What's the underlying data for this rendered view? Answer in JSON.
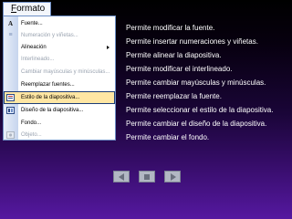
{
  "menu": {
    "title_mnemonic": "F",
    "title_rest": "ormato",
    "items": [
      {
        "label": "Fuente...",
        "icon": "font-A-icon",
        "disabled": false,
        "highlighted": false,
        "submenu": false
      },
      {
        "label": "Numeración y viñetas...",
        "icon": "numbering-icon",
        "disabled": true,
        "highlighted": false,
        "submenu": false
      },
      {
        "label": "Alineación",
        "icon": "align-icon",
        "disabled": false,
        "highlighted": false,
        "submenu": true
      },
      {
        "label": "Interlineado...",
        "icon": "line-spacing-icon",
        "disabled": true,
        "highlighted": false,
        "submenu": false
      },
      {
        "label": "Cambiar mayúsculas y minúsculas...",
        "icon": "change-case-icon",
        "disabled": true,
        "highlighted": false,
        "submenu": false
      },
      {
        "label": "Reemplazar fuentes...",
        "icon": "replace-fonts-icon",
        "disabled": false,
        "highlighted": false,
        "submenu": false
      },
      {
        "label": "Estilo de la diapositiva...",
        "icon": "slide-style-icon",
        "disabled": false,
        "highlighted": true,
        "submenu": false
      },
      {
        "label": "Diseño de la diapositiva...",
        "icon": "slide-layout-icon",
        "disabled": false,
        "highlighted": false,
        "submenu": false
      },
      {
        "label": "Fondo...",
        "icon": "background-icon",
        "disabled": false,
        "highlighted": false,
        "submenu": false
      },
      {
        "label": "Objeto...",
        "icon": "object-icon",
        "disabled": true,
        "highlighted": false,
        "submenu": false
      }
    ]
  },
  "descriptions": [
    "Permite modificar la fuente.",
    "Permite insertar numeraciones y viñetas.",
    "Permite alinear la diapositiva.",
    "Permite modificar el interlineado.",
    "Permite cambiar mayúsculas y minúsculas.",
    "Permite reemplazar la fuente.",
    "Permite seleccionar el estilo de la diapositiva.",
    "Permite cambiar el diseño de la diapositiva.",
    "Permite cambiar el fondo."
  ],
  "nav": [
    "previous-slide",
    "home",
    "next-slide"
  ]
}
